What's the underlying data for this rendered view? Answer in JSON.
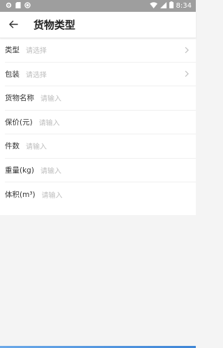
{
  "status_bar": {
    "time": "8:34",
    "icons": [
      "gear-icon",
      "sim-card-icon",
      "circle-icon",
      "wifi-icon",
      "signal-icon",
      "battery-icon"
    ]
  },
  "header": {
    "back_icon": "arrow-left-icon",
    "title": "货物类型"
  },
  "form": {
    "rows": [
      {
        "label": "类型",
        "placeholder": "请选择",
        "has_arrow": true
      },
      {
        "label": "包装",
        "placeholder": "请选择",
        "has_arrow": true
      },
      {
        "label": "货物名称",
        "placeholder": "请输入",
        "has_arrow": false
      },
      {
        "label": "保价(元)",
        "placeholder": "请输入",
        "has_arrow": false
      },
      {
        "label": "件数",
        "placeholder": "请输入",
        "has_arrow": false
      },
      {
        "label": "重量(kg)",
        "placeholder": "请输入",
        "has_arrow": false
      },
      {
        "label": "体积(m³)",
        "placeholder": "请输入",
        "has_arrow": false
      }
    ]
  },
  "colors": {
    "status_bar": "#9e9e9e",
    "placeholder": "#bdbdbd",
    "page_bg": "#f4f4f4"
  }
}
